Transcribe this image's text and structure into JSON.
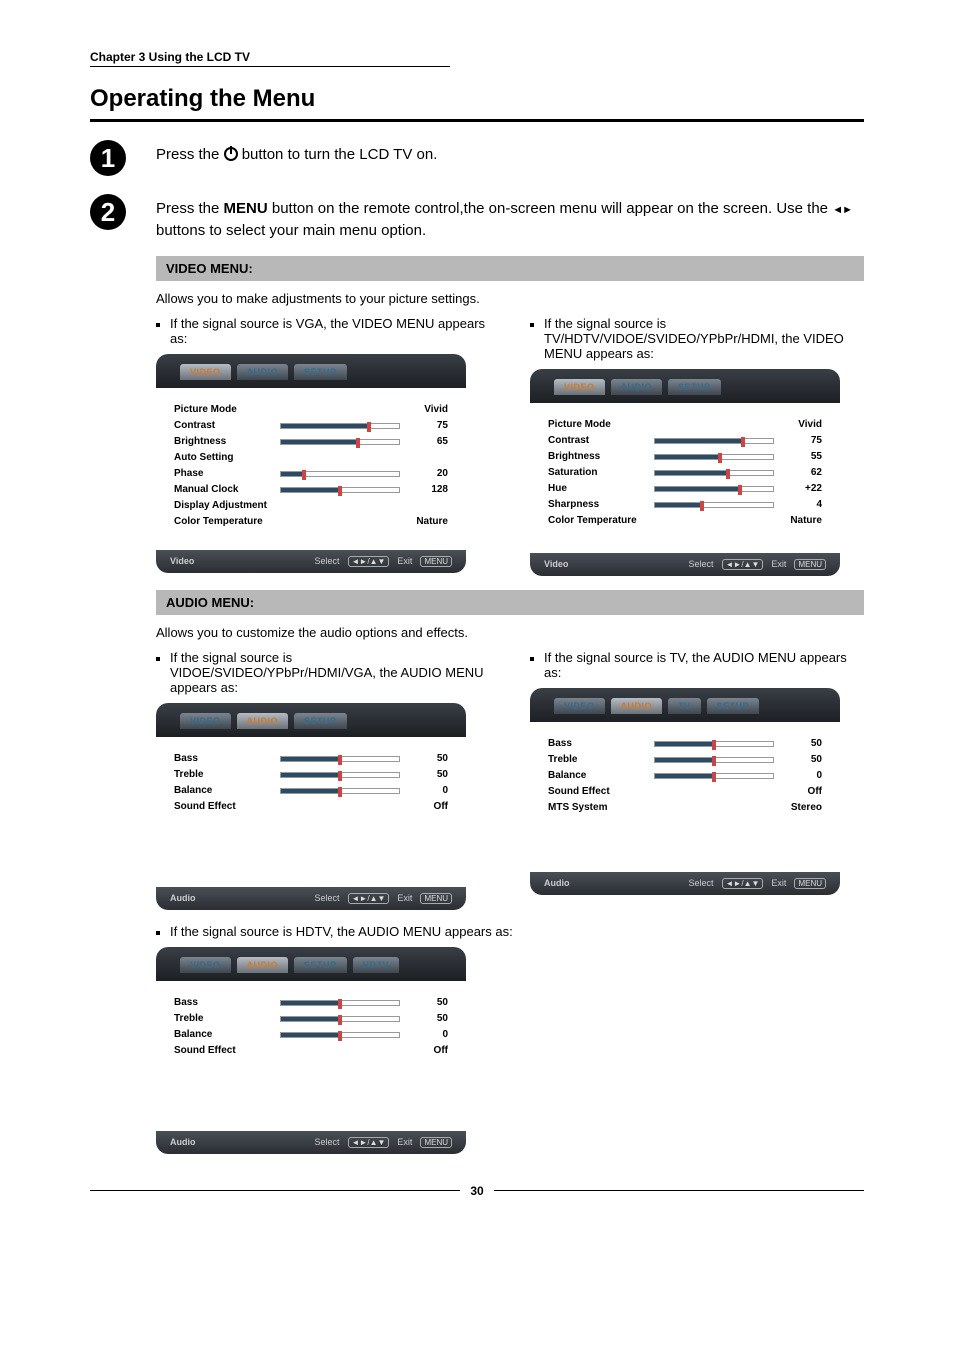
{
  "chapter": "Chapter 3 Using the LCD TV",
  "title": "Operating the Menu",
  "step1": {
    "pre": "Press the ",
    "post": " button to turn the LCD TV on."
  },
  "step2": {
    "pre": "Press the ",
    "menu_word": "MENU",
    "mid": " button on the remote control,the on-screen menu will appear on the screen. Use the ",
    "post": " buttons to select your main menu option."
  },
  "video_section": {
    "bar": "VIDEO MENU:",
    "desc": "Allows you to make adjustments to your picture settings.",
    "left_intro": "If the signal source is VGA, the VIDEO MENU appears as:",
    "right_intro": "If the signal source is TV/HDTV/VIDOE/SVIDEO/YPbPr/HDMI, the VIDEO MENU appears as:"
  },
  "audio_section": {
    "bar": "AUDIO MENU:",
    "desc": "Allows you to customize the audio options and effects.",
    "left_intro": "If the signal source is VIDOE/SVIDEO/YPbPr/HDMI/VGA, the AUDIO MENU appears as:",
    "right_intro": "If the signal source is TV, the AUDIO MENU appears as:",
    "below_intro": "If the signal source is HDTV, the AUDIO MENU appears as:"
  },
  "osd_common": {
    "tab_video": "VIDEO",
    "tab_audio": "AUDIO",
    "tab_setup": "SETUP",
    "tab_tv": "TV",
    "tab_hdtv": "HDTV",
    "footer_select": "Select",
    "footer_exit": "Exit",
    "footer_menu_key": "MENU"
  },
  "osd_video_vga": {
    "footer_label": "Video",
    "rows": [
      {
        "label": "Picture Mode",
        "value": "Vivid",
        "bar": null
      },
      {
        "label": "Contrast",
        "value": "75",
        "bar": 75
      },
      {
        "label": "Brightness",
        "value": "65",
        "bar": 65
      },
      {
        "label": "Auto Setting",
        "value": "",
        "bar": null
      },
      {
        "label": "Phase",
        "value": "20",
        "bar": 20
      },
      {
        "label": "Manual Clock",
        "value": "128",
        "bar": 50
      },
      {
        "label": "Display Adjustment",
        "value": "",
        "bar": null
      },
      {
        "label": "Color Temperature",
        "value": "Nature",
        "bar": null
      }
    ]
  },
  "osd_video_tv": {
    "footer_label": "Video",
    "rows": [
      {
        "label": "Picture Mode",
        "value": "Vivid",
        "bar": null
      },
      {
        "label": "Contrast",
        "value": "75",
        "bar": 75
      },
      {
        "label": "Brightness",
        "value": "55",
        "bar": 55
      },
      {
        "label": "Saturation",
        "value": "62",
        "bar": 62
      },
      {
        "label": "Hue",
        "value": "+22",
        "bar": 72
      },
      {
        "label": "Sharpness",
        "value": "4",
        "bar": 40
      },
      {
        "label": "Color Temperature",
        "value": "Nature",
        "bar": null
      }
    ]
  },
  "osd_audio_main": {
    "footer_label": "Audio",
    "rows": [
      {
        "label": "Bass",
        "value": "50",
        "bar": 50
      },
      {
        "label": "Treble",
        "value": "50",
        "bar": 50
      },
      {
        "label": "Balance",
        "value": "0",
        "bar": 50
      },
      {
        "label": "Sound Effect",
        "value": "Off",
        "bar": null
      }
    ]
  },
  "osd_audio_tv": {
    "footer_label": "Audio",
    "rows": [
      {
        "label": "Bass",
        "value": "50",
        "bar": 50
      },
      {
        "label": "Treble",
        "value": "50",
        "bar": 50
      },
      {
        "label": "Balance",
        "value": "0",
        "bar": 50
      },
      {
        "label": "Sound Effect",
        "value": "Off",
        "bar": null
      },
      {
        "label": "MTS System",
        "value": "Stereo",
        "bar": null
      }
    ]
  },
  "osd_audio_hdtv": {
    "footer_label": "Audio",
    "rows": [
      {
        "label": "Bass",
        "value": "50",
        "bar": 50
      },
      {
        "label": "Treble",
        "value": "50",
        "bar": 50
      },
      {
        "label": "Balance",
        "value": "0",
        "bar": 50
      },
      {
        "label": "Sound Effect",
        "value": "Off",
        "bar": null
      }
    ]
  },
  "page_number": "30"
}
